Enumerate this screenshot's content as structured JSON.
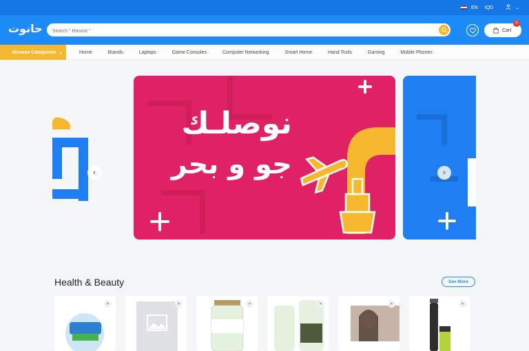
{
  "topbar": {
    "language": "EN",
    "currency": "IQD"
  },
  "header": {
    "logo_text": "حانوت",
    "search_placeholder": "Search \" Hanoot \"",
    "cart_label": "Cart",
    "cart_count": "0"
  },
  "nav": {
    "browse_label": "Browse Categories",
    "links": [
      "Home",
      "Brands",
      "Laptops",
      "Game Consoles",
      "Computer Networking",
      "Smart Home",
      "Hand Tools",
      "Gaming",
      "Mobile Phones"
    ]
  },
  "banner": {
    "line1": "نوصلـك",
    "line2": "جو و بحر"
  },
  "section": {
    "title": "Health & Beauty",
    "see_more": "See More"
  },
  "products": [
    {
      "image": "fridge-product"
    },
    {
      "image": "placeholder-image"
    },
    {
      "image": "jar-product"
    },
    {
      "image": "jar-product-2"
    },
    {
      "image": "woman-photo"
    },
    {
      "image": "trimmer-product"
    }
  ],
  "colors": {
    "primary": "#1d8cf8",
    "accent": "#f5b82e",
    "banner_bg": "#e02163",
    "banner_blue": "#1f7ff2"
  }
}
